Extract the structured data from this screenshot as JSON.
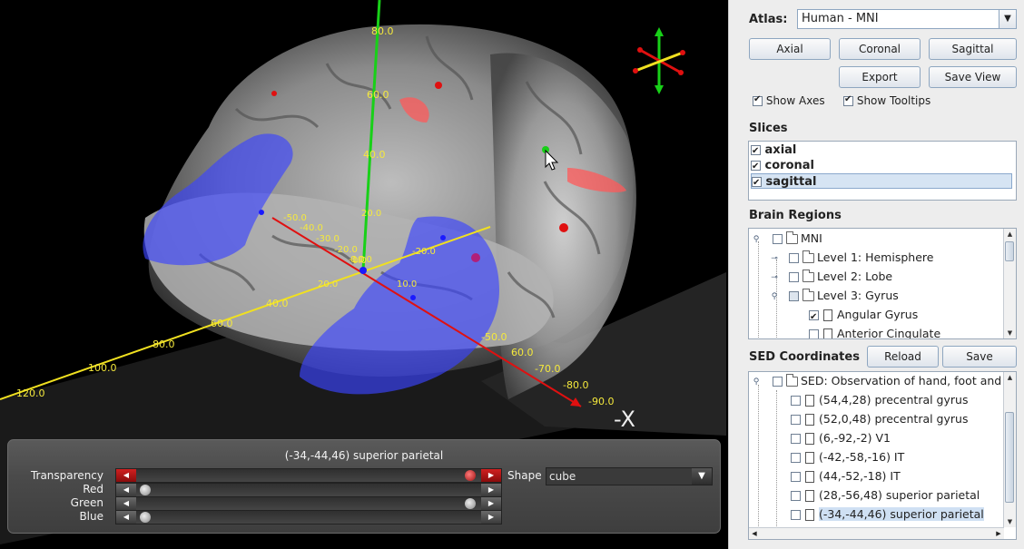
{
  "viewport": {
    "axis_y_labels": [
      "80.0",
      "60.0",
      "40.0",
      "20.0",
      "0.0"
    ],
    "axis_yellow_labels": [
      "120.0",
      "100.0",
      "80.0",
      "60.0",
      "40.0",
      "20.0",
      "0.0",
      "-20.0"
    ],
    "axis_red_labels": [
      "-50.0",
      "-40.0",
      "-30.0",
      "-20.0",
      "-10.0",
      "10.0",
      "-50.0",
      "60.0",
      "-70.0",
      "-80.0",
      "-90.0"
    ],
    "axis_direction_label": "-X",
    "colors": {
      "x_axis": "#e01010",
      "y_axis": "#18d018",
      "z_axis": "#f0e020",
      "region_blue": "#3a44ff",
      "region_red": "#ff5a5a"
    },
    "control_panel": {
      "title": "(-34,-44,46) superior parietal",
      "sliders": [
        {
          "label": "Transparency",
          "value_fraction": 0.95
        },
        {
          "label": "Red",
          "value_fraction": 0.0
        },
        {
          "label": "Green",
          "value_fraction": 0.95
        },
        {
          "label": "Blue",
          "value_fraction": 0.0
        }
      ],
      "shape_label": "Shape",
      "shape_value": "cube"
    }
  },
  "panel": {
    "atlas_label": "Atlas:",
    "atlas_value": "Human - MNI",
    "buttons": {
      "axial": "Axial",
      "coronal": "Coronal",
      "sagittal": "Sagittal",
      "export": "Export",
      "save_view": "Save View"
    },
    "options": {
      "show_axes": "Show Axes",
      "show_tooltips": "Show Tooltips"
    },
    "slices_header": "Slices",
    "slices": [
      {
        "label": "axial",
        "checked": true
      },
      {
        "label": "coronal",
        "checked": true
      },
      {
        "label": "sagittal",
        "checked": true
      }
    ],
    "regions_header": "Brain Regions",
    "regions": [
      {
        "label": "MNI"
      },
      {
        "label": "Level 1: Hemisphere"
      },
      {
        "label": "Level 2: Lobe"
      },
      {
        "label": "Level 3: Gyrus"
      },
      {
        "label": "Angular Gyrus"
      },
      {
        "label": "Anterior Cingulate"
      }
    ],
    "sed_header": "SED Coordinates",
    "sed_buttons": {
      "reload": "Reload",
      "save": "Save"
    },
    "sed_root": "SED: Observation of hand, foot and",
    "sed_items": [
      "(54,4,28) precentral gyrus",
      "(52,0,48) precentral gyrus",
      "(6,-92,-2) V1",
      "(-42,-58,-16) IT",
      "(44,-52,-18) IT",
      "(28,-56,48) superior parietal",
      "(-34,-44,46) superior parietal"
    ]
  }
}
